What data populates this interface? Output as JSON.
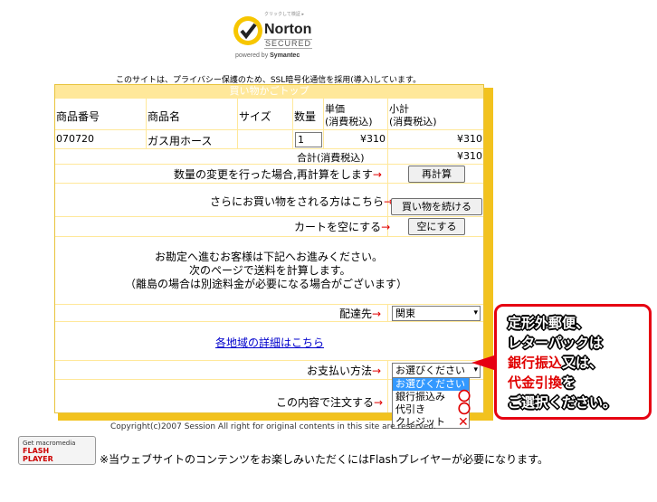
{
  "norton": {
    "tiny_text": "クリックして検証 ▸",
    "name": "Norton",
    "secured": "SECURED",
    "powered_prefix": "powered by ",
    "powered_brand": "Symantec"
  },
  "ssl_note": "このサイトは、プライバシー保護のため、SSL暗号化通信を採用(導入)しています。",
  "cart": {
    "title": "買い物かごトップ",
    "headers": [
      "商品番号",
      "商品名",
      "サイズ",
      "数量",
      "単価\n(消費税込)",
      "小計\n(消費税込)"
    ],
    "header_unit_price_1": "単価",
    "header_unit_price_2": "(消費税込)",
    "header_subtotal_1": "小計",
    "header_subtotal_2": "(消費税込)",
    "row": {
      "code": "070720",
      "name": "ガス用ホース",
      "size": "",
      "qty": "1",
      "unit_price": "¥310",
      "subtotal": "¥310"
    },
    "total_label": "合計(消費税込)",
    "total_value": "¥310",
    "recalc_text": "数量の変更を行った場合,再計算をします",
    "recalc_button": "再計算",
    "continue_text": "さらにお買い物をされる方はこちら",
    "continue_button": "買い物を続ける",
    "empty_text": "カートを空にする",
    "empty_button": "空にする",
    "notice_line1": "お勘定へ進むお客様は下記へお進みください。",
    "notice_line2": "次のページで送料を計算します。",
    "notice_line3": "（離島の場合は別途料金が必要になる場合がございます）",
    "dest_label": "配達先",
    "dest_value": "関東",
    "region_link": "各地域の詳細はこちら",
    "payment_label": "お支払い方法",
    "payment_value": "お選びください",
    "payment_options": [
      "お選びください",
      "銀行振込み",
      "代引き",
      "クレジット"
    ],
    "order_label": "この内容で注文する",
    "arrow": "→"
  },
  "callout": {
    "line1": "定形外郵便、",
    "line2": "レターパックは",
    "line3_red": "銀行振込",
    "line3_rest": "又は、",
    "line4_red": "代金引換",
    "line4_rest": "を",
    "line5": "ご選択ください。"
  },
  "marks": {
    "ok": "〇",
    "ng": "✕"
  },
  "copyright": "Copyright(c)2007 Session All right for original contents in this site are reserved.",
  "flash": {
    "badge_line1": "Get macromedia",
    "badge_line2": "FLASH",
    "badge_line3": "PLAYER",
    "note": "※当ウェブサイトのコンテンツをお楽しみいただくにはFlashプレイヤーが必要になります。"
  },
  "colors": {
    "panel": "#ffe89a",
    "panel_edge": "#f2c21e",
    "callout_border": "#e60012",
    "highlight": "#3399ff"
  }
}
